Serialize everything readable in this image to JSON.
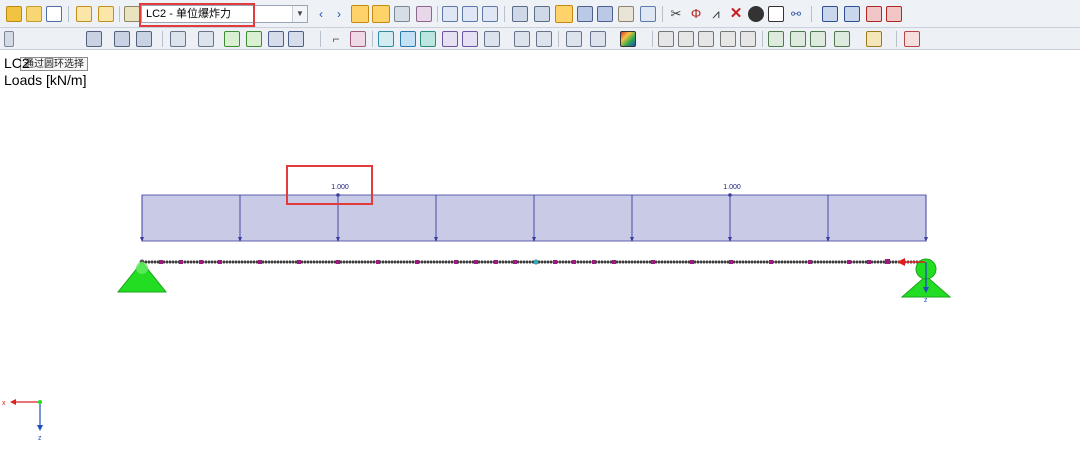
{
  "toolbar": {
    "load_case_combo": {
      "value": "LC2 - 单位爆炸力"
    },
    "tooltip": "通过圆环选择"
  },
  "view": {
    "load_case_title": "LC2",
    "load_subtitle": "Loads [kN/m]",
    "load_labels": [
      "1.000",
      "1.000"
    ],
    "support_axis_label": "z",
    "axes": {
      "x_label": "x",
      "z_label": "z"
    }
  },
  "colors": {
    "load_fill": "#c8cae6",
    "load_stroke": "#3b3ea0",
    "member": "#333333",
    "node": "#9b1a7e",
    "support": "#22dd22",
    "highlight": "#e23b3b"
  }
}
